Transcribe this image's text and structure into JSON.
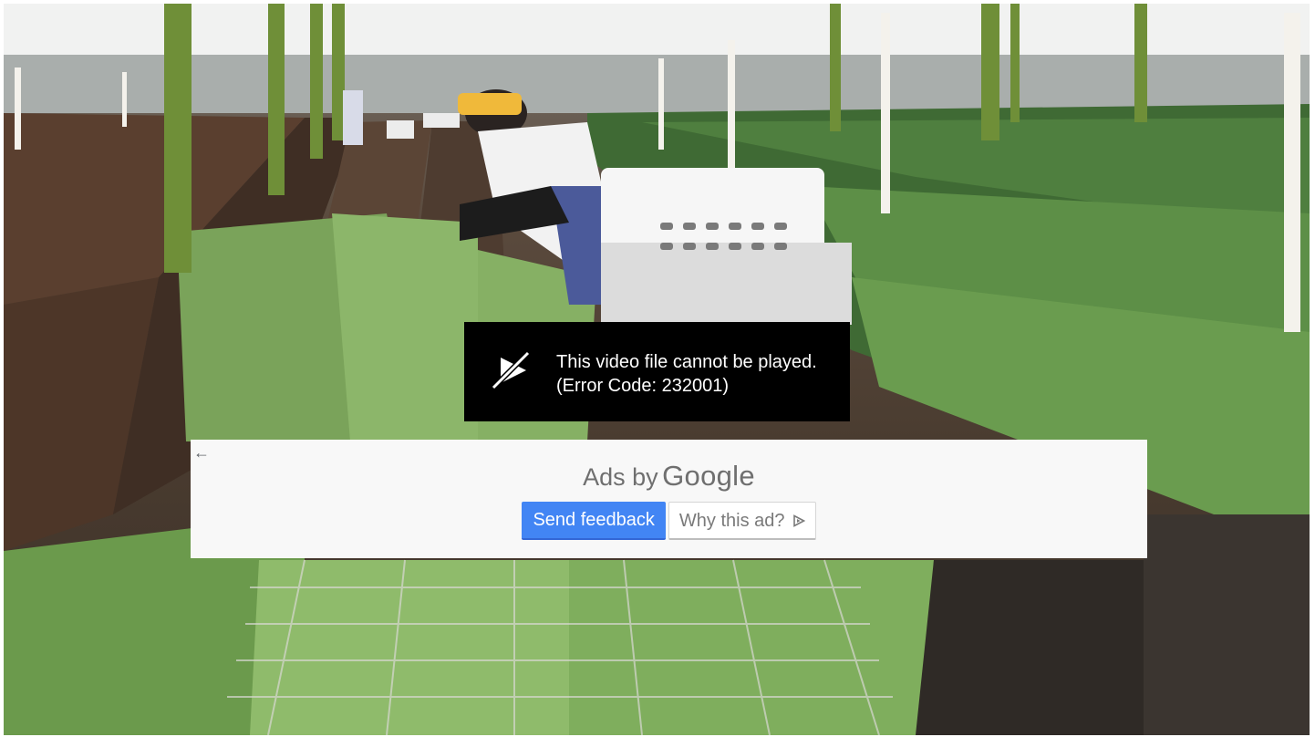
{
  "video": {
    "error_message": "This video file cannot be played.",
    "error_code": "(Error Code: 232001)",
    "error_icon": "video-unavailable-icon"
  },
  "ad_panel": {
    "back_icon": "arrow-left-icon",
    "back_glyph": "←",
    "ads_by_prefix": "Ads by",
    "ads_by_brand": "Google",
    "send_feedback_label": "Send feedback",
    "why_this_ad_label": "Why this ad?",
    "why_icon": "adchoices-triangle-icon"
  },
  "colors": {
    "feedback_button": "#4285f4",
    "error_box": "#000000",
    "panel_background": "#f8f8f8"
  }
}
